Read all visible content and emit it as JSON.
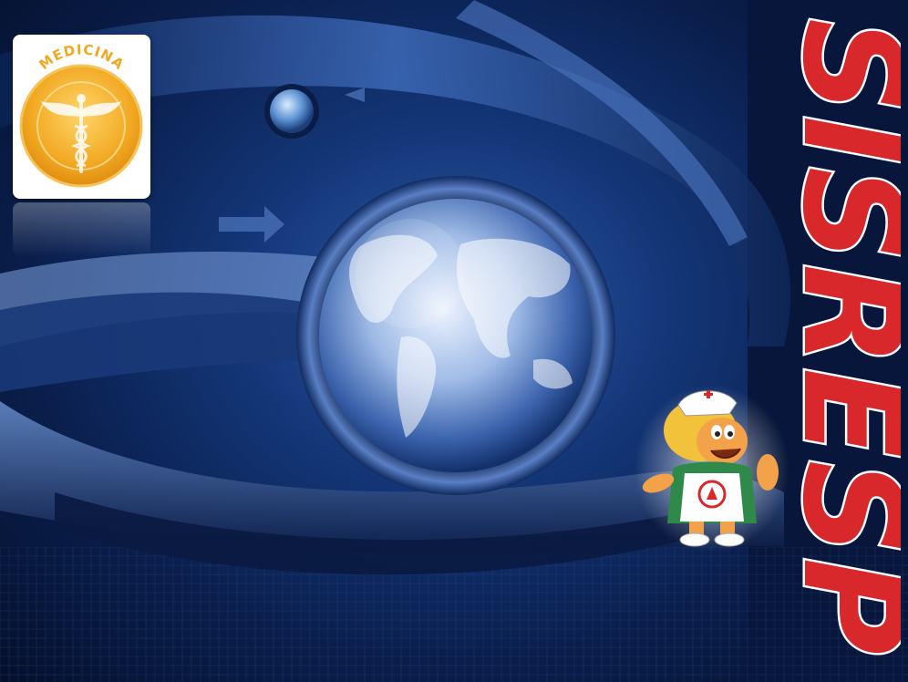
{
  "badge": {
    "label": "MEDICINA",
    "icon": "caduceus-icon",
    "color": "#f2a922"
  },
  "logo": {
    "text": "SISRESP",
    "color": "#d8282b"
  },
  "scene": {
    "globe_icon": "world-globe-icon",
    "small_globe_icon": "small-globe-icon",
    "mascot_icon": "nurse-mascot-icon",
    "background_color": "#0f2c66"
  }
}
